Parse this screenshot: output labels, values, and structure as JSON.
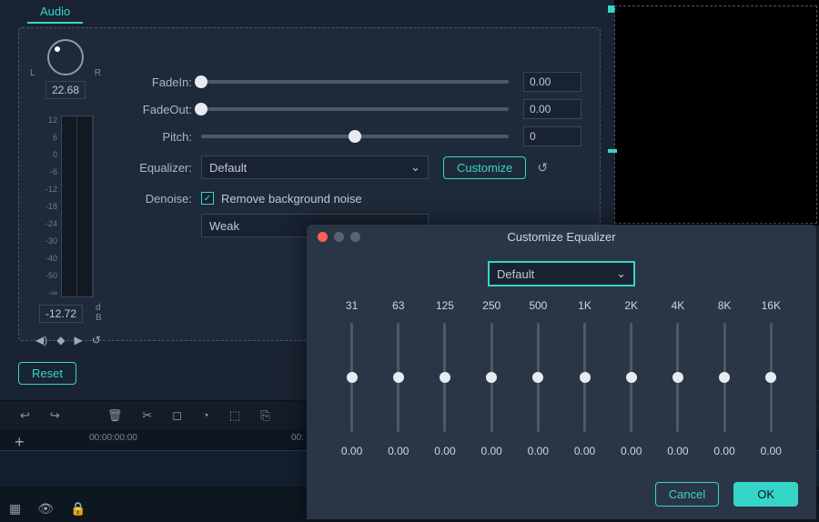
{
  "tab": {
    "label": "Audio"
  },
  "knob": {
    "value": "22.68",
    "L": "L",
    "R": "R"
  },
  "meter": {
    "scale": [
      "12",
      "6",
      "0",
      "-6",
      "-12",
      "-18",
      "-24",
      "-30",
      "-40",
      "-50",
      "-∞"
    ],
    "value": "-12.72",
    "unit_top": "d",
    "unit_bottom": "B"
  },
  "props": {
    "fadein": {
      "label": "FadeIn:",
      "value": "0.00",
      "pos": 0
    },
    "fadeout": {
      "label": "FadeOut:",
      "value": "0.00",
      "pos": 0
    },
    "pitch": {
      "label": "Pitch:",
      "value": "0",
      "pos": 50
    },
    "equalizer": {
      "label": "Equalizer:",
      "selected": "Default",
      "customize": "Customize"
    },
    "denoise": {
      "label": "Denoise:",
      "checkbox_label": "Remove background noise",
      "checked": true
    },
    "strength": {
      "selected": "Weak"
    }
  },
  "reset": {
    "label": "Reset"
  },
  "timeline": {
    "t0": "00:00:00:00",
    "t1": "00:"
  },
  "eq": {
    "title": "Customize Equalizer",
    "preset": "Default",
    "bands": [
      {
        "freq": "31",
        "val": "0.00"
      },
      {
        "freq": "63",
        "val": "0.00"
      },
      {
        "freq": "125",
        "val": "0.00"
      },
      {
        "freq": "250",
        "val": "0.00"
      },
      {
        "freq": "500",
        "val": "0.00"
      },
      {
        "freq": "1K",
        "val": "0.00"
      },
      {
        "freq": "2K",
        "val": "0.00"
      },
      {
        "freq": "4K",
        "val": "0.00"
      },
      {
        "freq": "8K",
        "val": "0.00"
      },
      {
        "freq": "16K",
        "val": "0.00"
      }
    ],
    "cancel": "Cancel",
    "ok": "OK"
  },
  "colors": {
    "accent": "#35d6c7"
  }
}
